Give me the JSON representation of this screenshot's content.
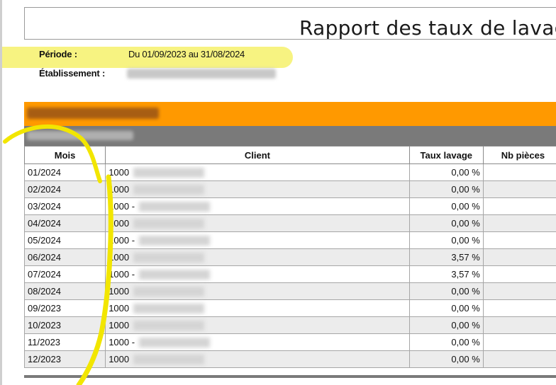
{
  "report": {
    "title": "Rapport des taux de lavage",
    "period_label": "Période :",
    "period_value": "Du 01/09/2023 au 31/08/2024",
    "establishment_label": "Établissement :"
  },
  "table": {
    "headers": [
      "Mois",
      "Client",
      "Taux lavage",
      "Nb pièces"
    ],
    "rows": [
      {
        "mois": "01/2024",
        "client": "1000",
        "taux": "0,00 %"
      },
      {
        "mois": "02/2024",
        "client": "1000",
        "taux": "0,00 %"
      },
      {
        "mois": "03/2024",
        "client": "1000 -",
        "taux": "0,00 %"
      },
      {
        "mois": "04/2024",
        "client": "1000",
        "taux": "0,00 %"
      },
      {
        "mois": "05/2024",
        "client": "1000 -",
        "taux": "0,00 %"
      },
      {
        "mois": "06/2024",
        "client": "1000",
        "taux": "3,57 %"
      },
      {
        "mois": "07/2024",
        "client": "1000 -",
        "taux": "3,57 %"
      },
      {
        "mois": "08/2024",
        "client": "1000",
        "taux": "0,00 %"
      },
      {
        "mois": "09/2023",
        "client": "1000",
        "taux": "0,00 %"
      },
      {
        "mois": "10/2023",
        "client": "1000",
        "taux": "0,00 %"
      },
      {
        "mois": "11/2023",
        "client": "1000 -",
        "taux": "0,00 %"
      },
      {
        "mois": "12/2023",
        "client": "1000",
        "taux": "0,00 %"
      }
    ]
  },
  "colors": {
    "group_bar": "#ff9900",
    "subgroup_bar": "#7a7a7a",
    "highlight": "#f7f27a",
    "annotation_stroke": "#f2e600"
  }
}
